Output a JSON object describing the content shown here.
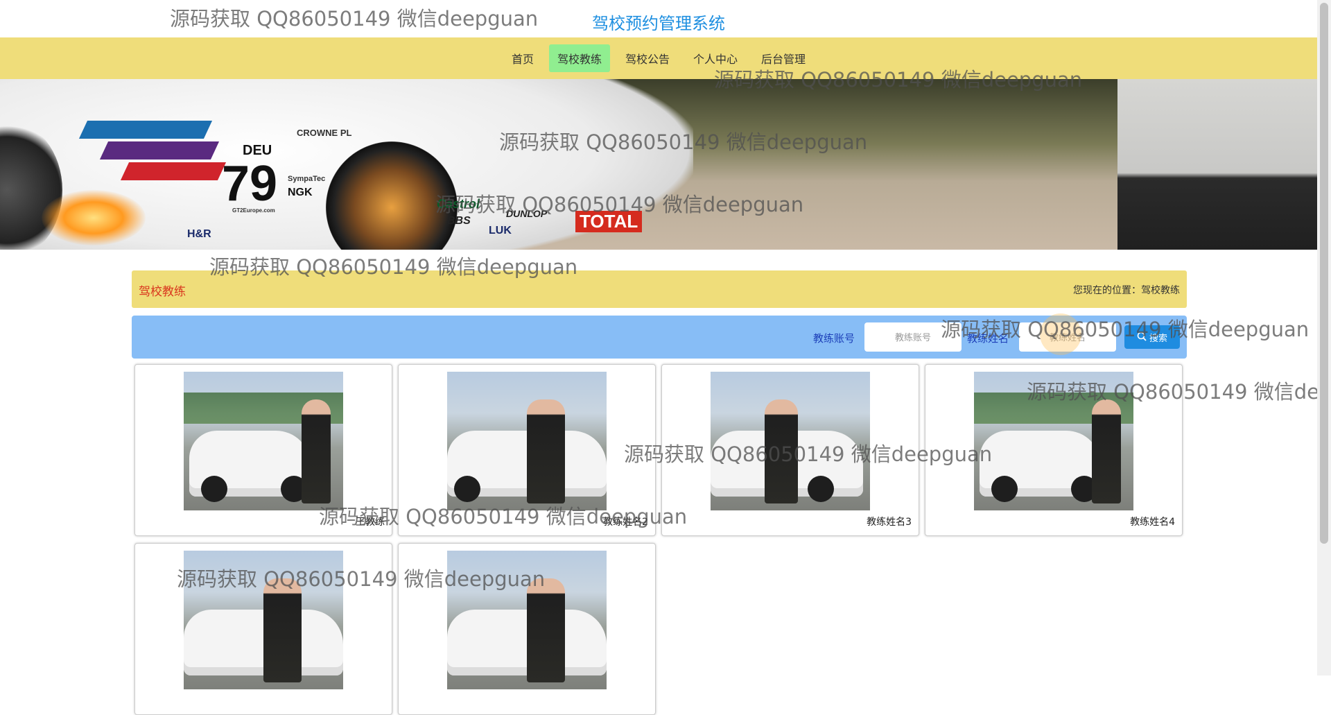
{
  "header": {
    "title": "驾校预约管理系统"
  },
  "nav": {
    "items": [
      {
        "label": "首页",
        "active": false
      },
      {
        "label": "驾校教练",
        "active": true
      },
      {
        "label": "驾校公告",
        "active": false
      },
      {
        "label": "个人中心",
        "active": false
      },
      {
        "label": "后台管理",
        "active": false
      }
    ]
  },
  "banner": {
    "car_number": "79",
    "car_country": "DEU",
    "sponsors": [
      "CROWNE PL",
      "TOTAL",
      "DUNLOP",
      "Castrol",
      "BBS",
      "LUK",
      "NGK",
      "H&R",
      "SympaTec",
      "GT2Europe.com"
    ]
  },
  "breadcrumb": {
    "section_title": "驾校教练",
    "location_text": "您现在的位置：驾校教练"
  },
  "search": {
    "account_label": "教练账号",
    "account_placeholder": "教练账号",
    "name_label": "教练姓名",
    "name_placeholder": "教练姓名",
    "button_label": "搜索",
    "button_icon": "search-icon"
  },
  "coaches": [
    {
      "name": "王教练"
    },
    {
      "name": "教练姓名2"
    },
    {
      "name": "教练姓名3"
    },
    {
      "name": "教练姓名4"
    },
    {
      "name": ""
    },
    {
      "name": ""
    }
  ],
  "watermark": "源码获取 QQ86050149 微信deepguan",
  "colors": {
    "navbar": "#efdd7a",
    "active_nav": "#90ee90",
    "title": "#1e8fe0",
    "search_bar": "#87bdf6",
    "search_button": "#1f8ce0",
    "section_title": "#d9361e"
  }
}
